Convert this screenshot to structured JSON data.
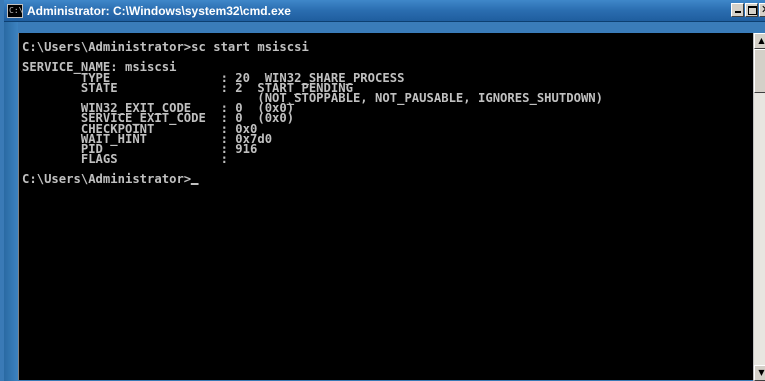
{
  "window": {
    "title": "Administrator: C:\\Windows\\system32\\cmd.exe",
    "icon_text": "C:\\"
  },
  "console": {
    "lines": [
      "C:\\Users\\Administrator>sc start msiscsi",
      "",
      "SERVICE_NAME: msiscsi",
      "        TYPE               : 20  WIN32_SHARE_PROCESS",
      "        STATE              : 2  START_PENDING",
      "                                (NOT_STOPPABLE, NOT_PAUSABLE, IGNORES_SHUTDOWN)",
      "        WIN32_EXIT_CODE    : 0  (0x0)",
      "        SERVICE_EXIT_CODE  : 0  (0x0)",
      "        CHECKPOINT         : 0x0",
      "        WAIT_HINT          : 0x7d0",
      "        PID                : 916",
      "        FLAGS              :",
      "",
      "C:\\Users\\Administrator>"
    ]
  },
  "scrollbar": {
    "up_glyph": "▲",
    "down_glyph": "▼"
  }
}
